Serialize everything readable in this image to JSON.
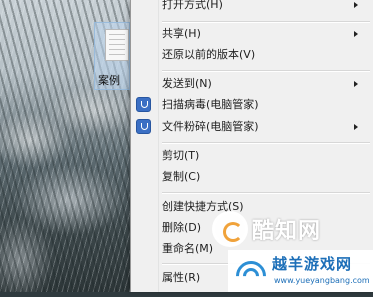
{
  "desktop": {
    "file_name": "案例"
  },
  "context_menu": {
    "items": [
      {
        "label": "打开方式(H)",
        "submenu": true
      },
      {
        "label": "共享(H)",
        "submenu": true
      },
      {
        "label": "还原以前的版本(V)",
        "submenu": false
      },
      {
        "label": "发送到(N)",
        "submenu": true
      },
      {
        "label": "扫描病毒(电脑管家)",
        "submenu": false,
        "icon": "shield-icon"
      },
      {
        "label": "文件粉碎(电脑管家)",
        "submenu": true,
        "icon": "shield-icon"
      },
      {
        "label": "剪切(T)",
        "submenu": false
      },
      {
        "label": "复制(C)",
        "submenu": false
      },
      {
        "label": "创建快捷方式(S)",
        "submenu": false
      },
      {
        "label": "删除(D)",
        "submenu": false
      },
      {
        "label": "重命名(M)",
        "submenu": false
      },
      {
        "label": "属性(R)",
        "submenu": false
      }
    ]
  },
  "watermarks": {
    "zhi": "酷知网",
    "yu_brand": "越羊游戏网",
    "yu_url": "www.yueyangbang.com"
  },
  "colors": {
    "menu_bg": "#f0f0f0",
    "shield_blue": "#3b6fc4",
    "watermark_blue": "#1d6fb8"
  }
}
